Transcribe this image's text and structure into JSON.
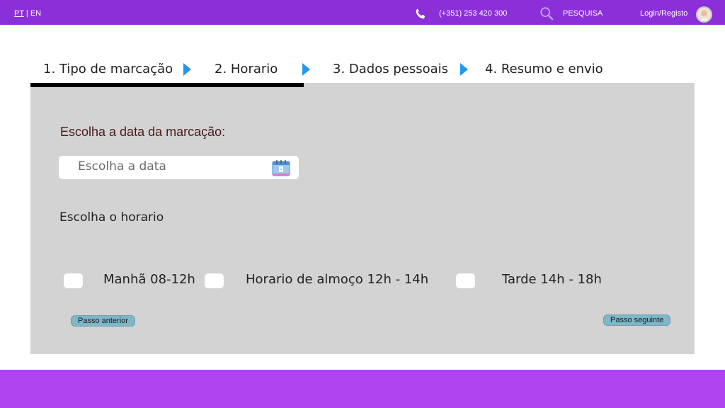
{
  "topbar": {
    "lang_pt": "PT",
    "lang_sep": " | ",
    "lang_en": "EN",
    "phone": "(+351) 253 420 300",
    "search_label": "PESQUISA",
    "login_label": "Login/Registo"
  },
  "steps": {
    "step1": "1. Tipo de marcação",
    "step2": "2. Horario",
    "step3": "3. Dados pessoais",
    "step4": "4. Resumo e envio"
  },
  "form": {
    "date_label": "Escolha a data da marcação:",
    "date_placeholder": "Escolha a data",
    "time_label": "Escolha o horario",
    "options": [
      {
        "label": "Manhã 08-12h"
      },
      {
        "label": "Horario de almoço 12h - 14h"
      },
      {
        "label": "Tarde 14h - 18h"
      }
    ],
    "prev_button": "Passo anterior",
    "next_button": "Passo seguinte"
  },
  "colors": {
    "topbar": "#8b2fd9",
    "footer": "#b044ee",
    "panel": "#d3d3d3",
    "step_arrow": "#2196f3",
    "button": "#7fb6c8"
  },
  "icons": {
    "phone": "phone-icon",
    "search": "search-icon",
    "calendar": "calendar-icon",
    "avatar": "avatar"
  }
}
